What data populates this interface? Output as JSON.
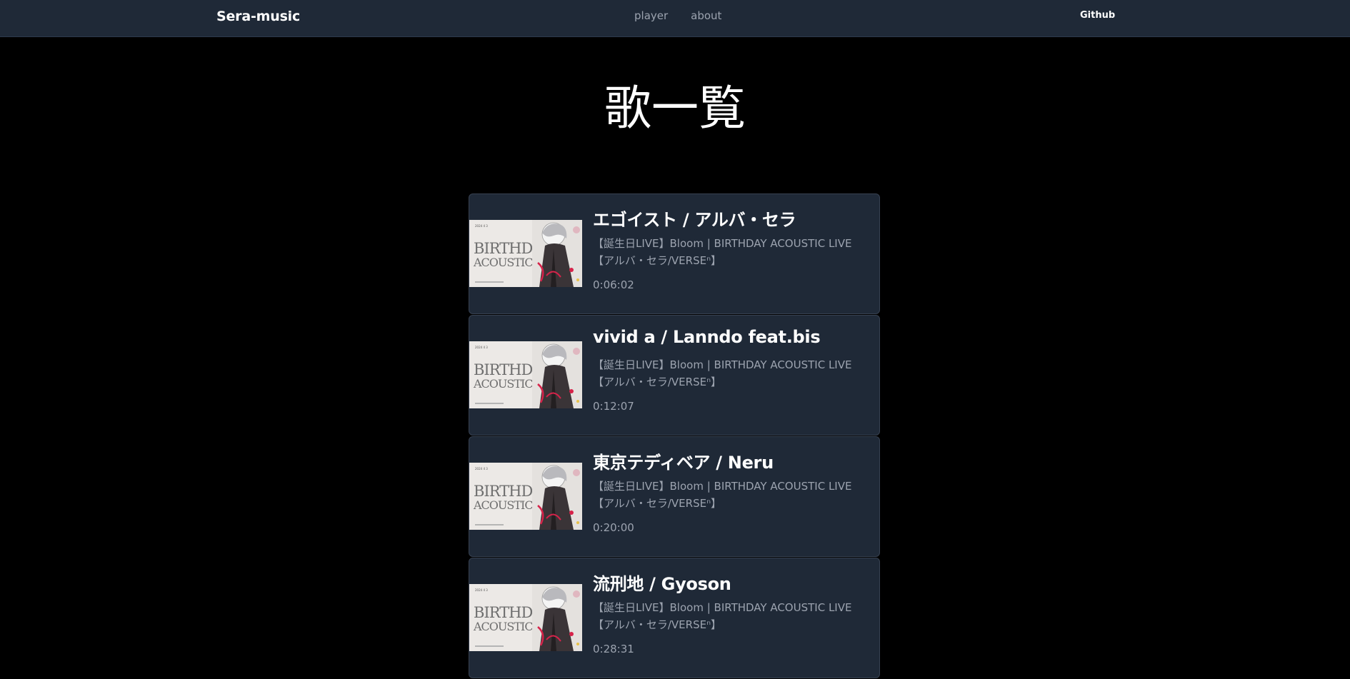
{
  "nav": {
    "brand": "Sera-music",
    "links": [
      "player",
      "about"
    ],
    "github": "Github"
  },
  "page": {
    "title": "歌一覧"
  },
  "thumbnail": {
    "small_text": "2024 4 3",
    "line1": "BIRTHDAY",
    "line2": "ACOUSTIC LIVE"
  },
  "songs": [
    {
      "title": "エゴイスト / アルバ・セラ",
      "description": "【誕生日LIVE】Bloom | BIRTHDAY ACOUSTIC LIVE【アルバ・セラ/VERSEⁿ】",
      "time": "0:06:02"
    },
    {
      "title": "vivid a / Lanndo feat.bis",
      "description": "【誕生日LIVE】Bloom | BIRTHDAY ACOUSTIC LIVE【アルバ・セラ/VERSEⁿ】",
      "time": "0:12:07"
    },
    {
      "title": "東京テディベア / Neru",
      "description": "【誕生日LIVE】Bloom | BIRTHDAY ACOUSTIC LIVE【アルバ・セラ/VERSEⁿ】",
      "time": "0:20:00"
    },
    {
      "title": "流刑地 / Gyoson",
      "description": "【誕生日LIVE】Bloom | BIRTHDAY ACOUSTIC LIVE【アルバ・セラ/VERSEⁿ】",
      "time": "0:28:31"
    }
  ],
  "colors": {
    "navbar_bg": "#1f2937",
    "page_bg": "#000000",
    "card_bg": "#1f2937",
    "muted_text": "#9ca3af"
  }
}
